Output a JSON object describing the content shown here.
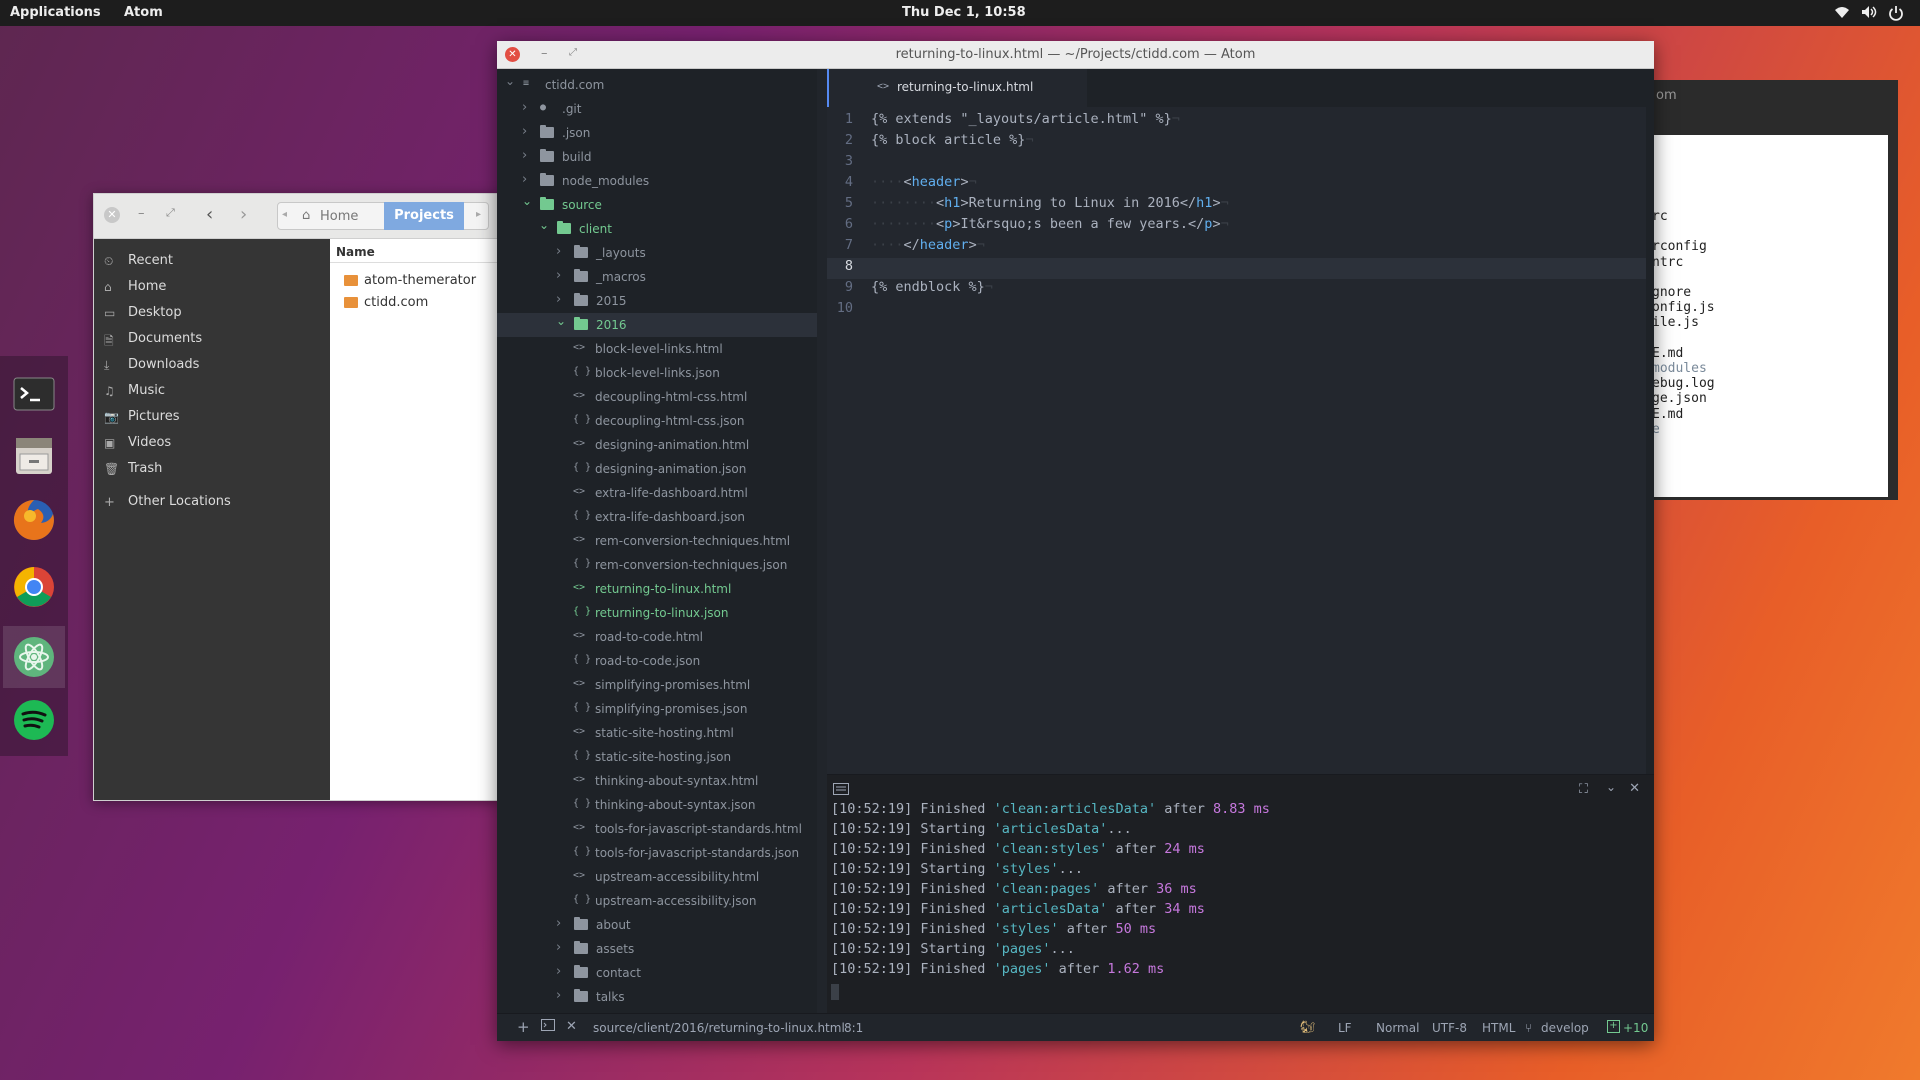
{
  "topbar": {
    "applications": "Applications",
    "app_name": "Atom",
    "clock": "Thu Dec  1, 10:58"
  },
  "dock": {
    "items": [
      "terminal",
      "files",
      "firefox",
      "chrome",
      "atom",
      "spotify"
    ]
  },
  "file_manager": {
    "breadcrumb": {
      "home": "Home",
      "current": "Projects"
    },
    "sidebar": [
      "Recent",
      "Home",
      "Desktop",
      "Documents",
      "Downloads",
      "Music",
      "Pictures",
      "Videos",
      "Trash"
    ],
    "other_locations": "Other Locations",
    "column_header": "Name",
    "items": [
      "atom-themerator",
      "ctidd.com"
    ]
  },
  "atom": {
    "title": "returning-to-linux.html — ~/Projects/ctidd.com — Atom",
    "tab": "returning-to-linux.html",
    "tree": [
      {
        "depth": 0,
        "type": "root",
        "name": "ctidd.com",
        "open": true
      },
      {
        "depth": 1,
        "type": "git",
        "name": ".git",
        "open": false
      },
      {
        "depth": 1,
        "type": "dir",
        "name": ".json",
        "open": false
      },
      {
        "depth": 1,
        "type": "dir",
        "name": "build",
        "open": false
      },
      {
        "depth": 1,
        "type": "dir",
        "name": "node_modules",
        "open": false
      },
      {
        "depth": 1,
        "type": "dir",
        "name": "source",
        "open": true,
        "green": true
      },
      {
        "depth": 2,
        "type": "dir",
        "name": "client",
        "open": true,
        "green": true
      },
      {
        "depth": 3,
        "type": "dir",
        "name": "_layouts",
        "open": false
      },
      {
        "depth": 3,
        "type": "dir",
        "name": "_macros",
        "open": false
      },
      {
        "depth": 3,
        "type": "dir",
        "name": "2015",
        "open": false
      },
      {
        "depth": 3,
        "type": "dir",
        "name": "2016",
        "open": true,
        "green": true,
        "selected": true
      },
      {
        "depth": 4,
        "type": "html",
        "name": "block-level-links.html"
      },
      {
        "depth": 4,
        "type": "json",
        "name": "block-level-links.json"
      },
      {
        "depth": 4,
        "type": "html",
        "name": "decoupling-html-css.html"
      },
      {
        "depth": 4,
        "type": "json",
        "name": "decoupling-html-css.json"
      },
      {
        "depth": 4,
        "type": "html",
        "name": "designing-animation.html"
      },
      {
        "depth": 4,
        "type": "json",
        "name": "designing-animation.json"
      },
      {
        "depth": 4,
        "type": "html",
        "name": "extra-life-dashboard.html"
      },
      {
        "depth": 4,
        "type": "json",
        "name": "extra-life-dashboard.json"
      },
      {
        "depth": 4,
        "type": "html",
        "name": "rem-conversion-techniques.html"
      },
      {
        "depth": 4,
        "type": "json",
        "name": "rem-conversion-techniques.json"
      },
      {
        "depth": 4,
        "type": "html",
        "name": "returning-to-linux.html",
        "green": true
      },
      {
        "depth": 4,
        "type": "json",
        "name": "returning-to-linux.json",
        "green": true
      },
      {
        "depth": 4,
        "type": "html",
        "name": "road-to-code.html"
      },
      {
        "depth": 4,
        "type": "json",
        "name": "road-to-code.json"
      },
      {
        "depth": 4,
        "type": "html",
        "name": "simplifying-promises.html"
      },
      {
        "depth": 4,
        "type": "json",
        "name": "simplifying-promises.json"
      },
      {
        "depth": 4,
        "type": "html",
        "name": "static-site-hosting.html"
      },
      {
        "depth": 4,
        "type": "json",
        "name": "static-site-hosting.json"
      },
      {
        "depth": 4,
        "type": "html",
        "name": "thinking-about-syntax.html"
      },
      {
        "depth": 4,
        "type": "json",
        "name": "thinking-about-syntax.json"
      },
      {
        "depth": 4,
        "type": "html",
        "name": "tools-for-javascript-standards.html"
      },
      {
        "depth": 4,
        "type": "json",
        "name": "tools-for-javascript-standards.json"
      },
      {
        "depth": 4,
        "type": "html",
        "name": "upstream-accessibility.html"
      },
      {
        "depth": 4,
        "type": "json",
        "name": "upstream-accessibility.json"
      },
      {
        "depth": 3,
        "type": "dir",
        "name": "about",
        "open": false
      },
      {
        "depth": 3,
        "type": "dir",
        "name": "assets",
        "open": false
      },
      {
        "depth": 3,
        "type": "dir",
        "name": "contact",
        "open": false
      },
      {
        "depth": 3,
        "type": "dir",
        "name": "talks",
        "open": false
      }
    ],
    "code": [
      "{% extends \"_layouts/article.html\" %}",
      "{% block article %}",
      "",
      "    <header>",
      "        <h1>Returning to Linux in 2016</h1>",
      "        <p>It&rsquo;s been a few years.</p>",
      "    </header>",
      "",
      "{% endblock %}",
      ""
    ],
    "cursor_line": 8,
    "log": [
      {
        "time": "[10:52:19]",
        "verb": "Finished",
        "task": "'clean:articlesData'",
        "after": "after",
        "dur": "8.83 ms"
      },
      {
        "time": "[10:52:19]",
        "verb": "Starting",
        "task": "'articlesData'",
        "after": "...",
        "dur": ""
      },
      {
        "time": "[10:52:19]",
        "verb": "Finished",
        "task": "'clean:styles'",
        "after": "after",
        "dur": "24 ms"
      },
      {
        "time": "[10:52:19]",
        "verb": "Starting",
        "task": "'styles'",
        "after": "...",
        "dur": ""
      },
      {
        "time": "[10:52:19]",
        "verb": "Finished",
        "task": "'clean:pages'",
        "after": "after",
        "dur": "36 ms"
      },
      {
        "time": "[10:52:19]",
        "verb": "Finished",
        "task": "'articlesData'",
        "after": "after",
        "dur": "34 ms"
      },
      {
        "time": "[10:52:19]",
        "verb": "Finished",
        "task": "'styles'",
        "after": "after",
        "dur": "50 ms"
      },
      {
        "time": "[10:52:19]",
        "verb": "Starting",
        "task": "'pages'",
        "after": "...",
        "dur": ""
      },
      {
        "time": "[10:52:19]",
        "verb": "Finished",
        "task": "'pages'",
        "after": "after",
        "dur": "1.62 ms"
      }
    ],
    "status": {
      "path": "source/client/2016/returning-to-linux.html",
      "cursor": "8:1",
      "line_ending": "LF",
      "mode": "Normal",
      "encoding": "UTF-8",
      "grammar": "HTML",
      "branch": "develop",
      "changes": "+10"
    }
  },
  "terminal": {
    "title": "om",
    "lines": [
      "rc",
      "",
      "rconfig",
      "ntrc",
      "",
      "gnore",
      "onfig.js",
      "ile.js",
      "",
      "E.md",
      "modules",
      "ebug.log",
      "ge.json",
      "E.md",
      "e"
    ]
  }
}
